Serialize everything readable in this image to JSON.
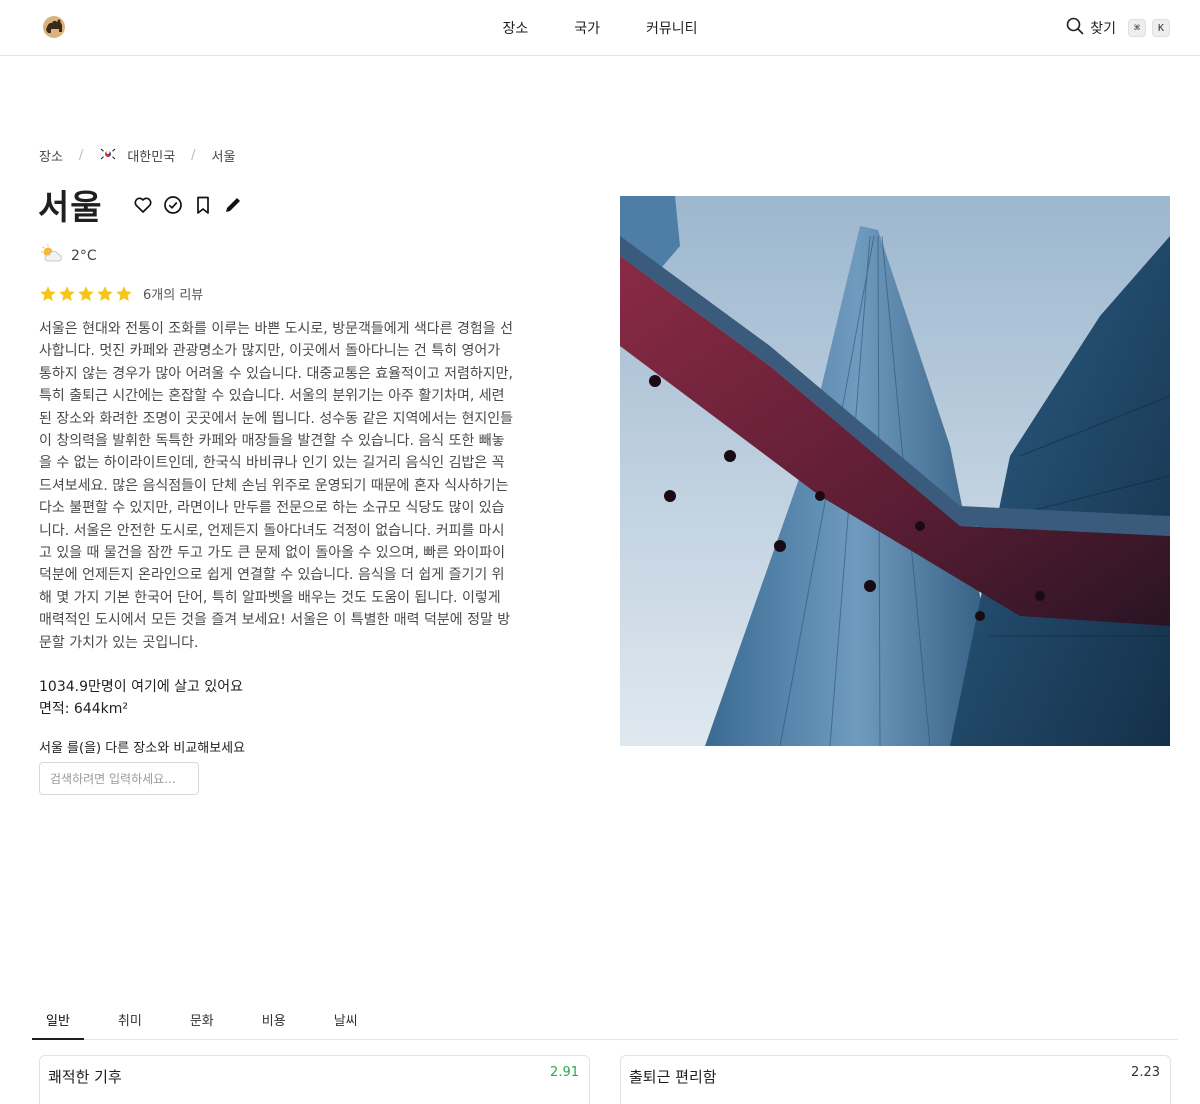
{
  "header": {
    "logo": "camel-logo",
    "nav": [
      {
        "label": "장소"
      },
      {
        "label": "국가"
      },
      {
        "label": "커뮤니티"
      }
    ],
    "search_label": "찾기",
    "shortcut_keys": [
      "⌘",
      "K"
    ]
  },
  "breadcrumb": {
    "root": "장소",
    "country": "대한민국",
    "country_flag": "south-korea-flag",
    "city": "서울"
  },
  "place": {
    "name": "서울",
    "weather_icon": "partly-cloudy-icon",
    "temperature": "2°C",
    "rating": 5,
    "rating_max": 5,
    "review_count_label": "6개의 리뷰",
    "description": "서울은 현대와 전통이 조화를 이루는 바쁜 도시로, 방문객들에게 색다른 경험을 선사합니다. 멋진 카페와 관광명소가 많지만, 이곳에서 돌아다니는 건 특히 영어가 통하지 않는 경우가 많아 어려울 수 있습니다. 대중교통은 효율적이고 저렴하지만, 특히 출퇴근 시간에는 혼잡할 수 있습니다. 서울의 분위기는 아주 활기차며, 세련된 장소와 화려한 조명이 곳곳에서 눈에 띕니다. 성수동 같은 지역에서는 현지인들이 창의력을 발휘한 독특한 카페와 매장들을 발견할 수 있습니다. 음식 또한 빼놓을 수 없는 하이라이트인데, 한국식 바비큐나 인기 있는 길거리 음식인 김밥은 꼭 드셔보세요. 많은 음식점들이 단체 손님 위주로 운영되기 때문에 혼자 식사하기는 다소 불편할 수 있지만, 라면이나 만두를 전문으로 하는 소규모 식당도 많이 있습니다. 서울은 안전한 도시로, 언제든지 돌아다녀도 걱정이 없습니다. 커피를 마시고 있을 때 물건을 잠깐 두고 가도 큰 문제 없이 돌아올 수 있으며, 빠른 와이파이 덕분에 언제든지 온라인으로 쉽게 연결할 수 있습니다. 음식을 더 쉽게 즐기기 위해 몇 가지 기본 한국어 단어, 특히 알파벳을 배우는 것도 도움이 됩니다. 이렇게 매력적인 도시에서 모든 것을 즐겨 보세요! 서울은 이 특별한 매력 덕분에 정말 방문할 가치가 있는 곳입니다.",
    "population": "1034.9만명이 여기에 살고 있어요",
    "area": "면적: 644km²",
    "compare_label": "서울 를(을) 다른 장소와 비교해보세요",
    "compare_placeholder": "검색하려면 입력하세요..."
  },
  "tabs": [
    {
      "label": "일반",
      "active": true
    },
    {
      "label": "취미",
      "active": false
    },
    {
      "label": "문화",
      "active": false
    },
    {
      "label": "비용",
      "active": false
    },
    {
      "label": "날씨",
      "active": false
    }
  ],
  "cards": [
    {
      "title": "쾌적한 기후",
      "score": "2.91",
      "score_color": "#2fa84f"
    },
    {
      "title": "출퇴근 편리함",
      "score": "2.23",
      "score_color": "#333333"
    }
  ],
  "colors": {
    "star": "#f5c518",
    "accent_green": "#2fa84f",
    "border": "#e3e3e3"
  }
}
